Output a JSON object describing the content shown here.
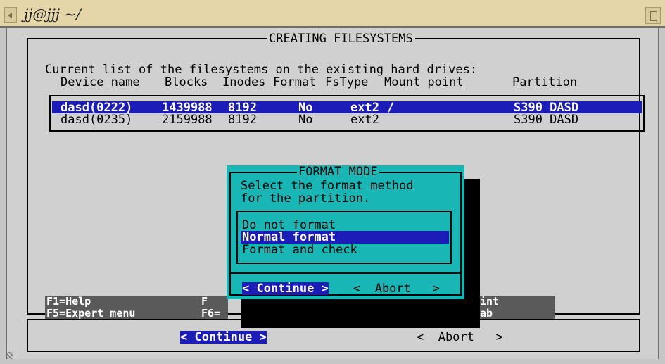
{
  "window": {
    "title": "jj@jjj ~/"
  },
  "screen": {
    "frame_title": "CREATING FILESYSTEMS",
    "intro": "Current list of the filesystems on the existing hard drives:",
    "columns": [
      "Device name",
      "Blocks",
      "Inodes",
      "Format",
      "FsType",
      "Mount point",
      "Partition"
    ],
    "rows": [
      {
        "device": "dasd(0222)",
        "blocks": "1439988",
        "inodes": "8192",
        "format": "No",
        "fstype": "ext2",
        "mount": "/",
        "partition": "S390 DASD",
        "selected": true
      },
      {
        "device": "dasd(0235)",
        "blocks": "2159988",
        "inodes": "8192",
        "format": "No",
        "fstype": "ext2",
        "mount": "",
        "partition": "S390 DASD",
        "selected": false
      }
    ]
  },
  "fkeys": {
    "f1": "F1=Help",
    "f5": "F5=Expert menu",
    "f_mid_top": "F",
    "f_mid_bottom": "F6=",
    "f_right_top": "int",
    "f_right_bottom": "ab"
  },
  "dialog": {
    "title": "FORMAT MODE",
    "prompt_line1": "Select the format method",
    "prompt_line2": "for the partition.",
    "options": [
      "Do not format",
      "Normal format",
      "Format and check"
    ],
    "selected_option": "Normal format",
    "continue_label": "< Continue >",
    "abort_label": "<  Abort   >"
  },
  "bottom_buttons": {
    "continue_label": "< Continue >",
    "abort_label": "<  Abort   >"
  },
  "colors": {
    "selection": "#1c1cb8",
    "dialog_bg": "#19b6b6",
    "terminal_bg": "#d0d0d0",
    "titlebar_bg": "#e4d6a8"
  }
}
